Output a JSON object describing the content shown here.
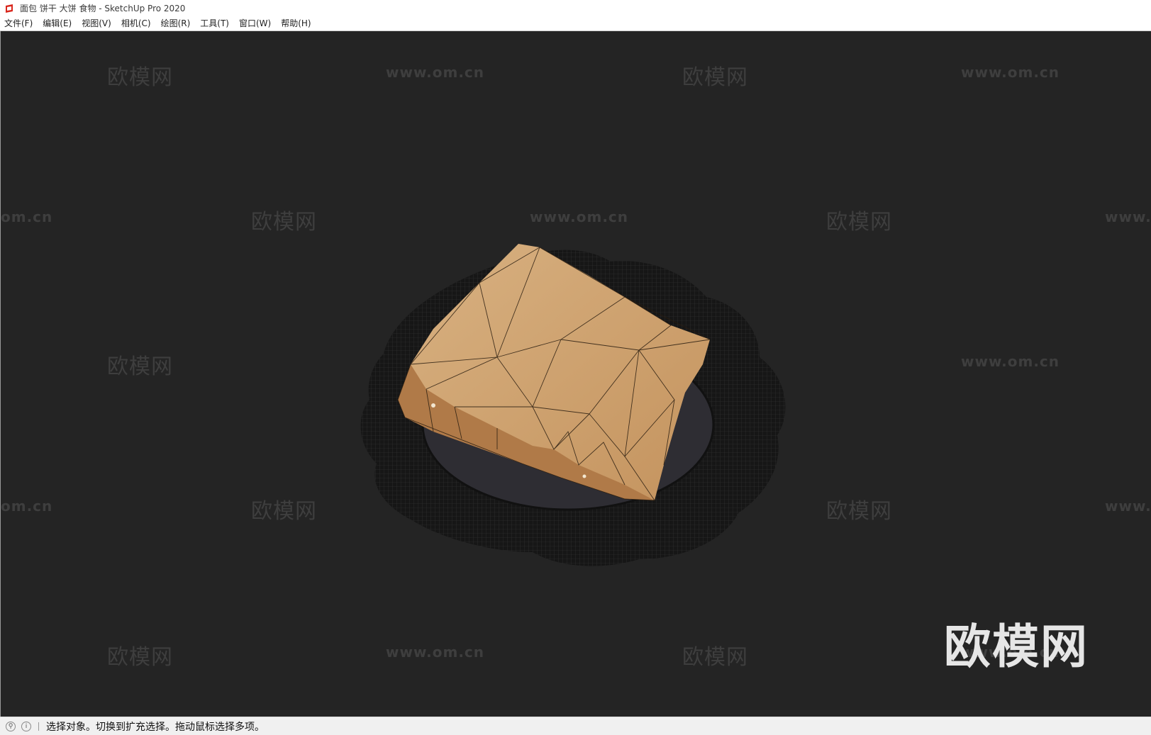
{
  "window": {
    "title": "面包 饼干 大饼 食物 - SketchUp Pro 2020",
    "app_icon": "sketchup-icon"
  },
  "menu": [
    {
      "label": "文件(F)"
    },
    {
      "label": "编辑(E)"
    },
    {
      "label": "视图(V)"
    },
    {
      "label": "相机(C)"
    },
    {
      "label": "绘图(R)"
    },
    {
      "label": "工具(T)"
    },
    {
      "label": "窗口(W)"
    },
    {
      "label": "帮助(H)"
    }
  ],
  "watermarks": {
    "cn": "欧模网",
    "url": "www.om.cn",
    "url_partial_left": "om.cn",
    "url_partial_right": "www."
  },
  "big_logo": "欧模网",
  "status": {
    "icons": [
      "geolocation-icon",
      "info-icon"
    ],
    "text": "选择对象。切换到扩充选择。拖动鼠标选择多项。"
  },
  "colors": {
    "viewport_bg": "#242424",
    "watermark": "#3e3e3e",
    "bread": "#c99d6b",
    "plate": "#1a1a1a"
  }
}
